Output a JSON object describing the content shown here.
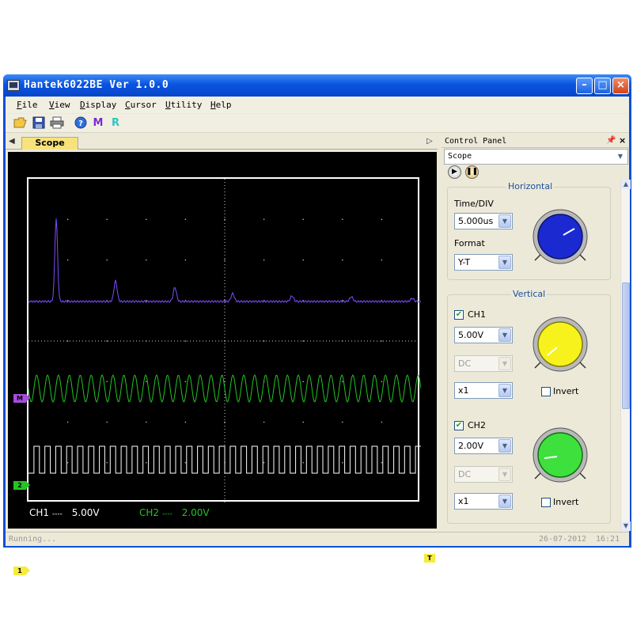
{
  "window": {
    "title": "Hantek6022BE Ver 1.0.0"
  },
  "menu": [
    {
      "label": "File",
      "u": "F",
      "rest": "ile"
    },
    {
      "label": "View",
      "u": "V",
      "rest": "iew"
    },
    {
      "label": "Display",
      "u": "D",
      "rest": "isplay"
    },
    {
      "label": "Cursor",
      "u": "C",
      "rest": "ursor"
    },
    {
      "label": "Utility",
      "u": "U",
      "rest": "tility"
    },
    {
      "label": "Help",
      "u": "H",
      "rest": "elp"
    }
  ],
  "toolbar": {
    "icons": [
      "open-folder-icon",
      "save-icon",
      "print-icon",
      "help-icon",
      "measure-icon",
      "reference-icon"
    ],
    "measure_label": "M",
    "reference_label": "R"
  },
  "scope": {
    "tab_label": "Scope",
    "markers": {
      "math": "M",
      "ch2": "2",
      "ch1": "1",
      "trigger": "T"
    },
    "ch1_scale_label": "CH1",
    "ch1_coupling": "----",
    "ch1_scale": "5.00V",
    "ch2_scale_label": "CH2",
    "ch2_coupling": "----",
    "ch2_scale": "2.00V",
    "colors": {
      "ch1": "#ffffff",
      "ch2": "#22c522",
      "math": "#7b4dff",
      "marker_math": "#a64ddc",
      "marker_ch2": "#22c522",
      "marker_ch1": "#f5ec3c",
      "trigger": "#f5ec3c"
    }
  },
  "control_panel": {
    "title": "Control Panel",
    "mode": "Scope",
    "horizontal": {
      "title": "Horizontal",
      "time_div_label": "Time/DIV",
      "time_div": "5.000us",
      "format_label": "Format",
      "format": "Y-T",
      "knob_color": "#1a2ad0"
    },
    "vertical": {
      "title": "Vertical",
      "ch1": {
        "label": "CH1",
        "volts": "5.00V",
        "coupling": "DC",
        "probe": "x1",
        "invert_label": "Invert",
        "enabled": true,
        "inverted": false,
        "knob_color": "#f7f21c"
      },
      "ch2": {
        "label": "CH2",
        "volts": "2.00V",
        "coupling": "DC",
        "probe": "x1",
        "invert_label": "Invert",
        "enabled": true,
        "inverted": false,
        "knob_color": "#3ee03e"
      }
    }
  },
  "status": {
    "left": "Running...",
    "date": "26-07-2012",
    "time": "16:21"
  }
}
